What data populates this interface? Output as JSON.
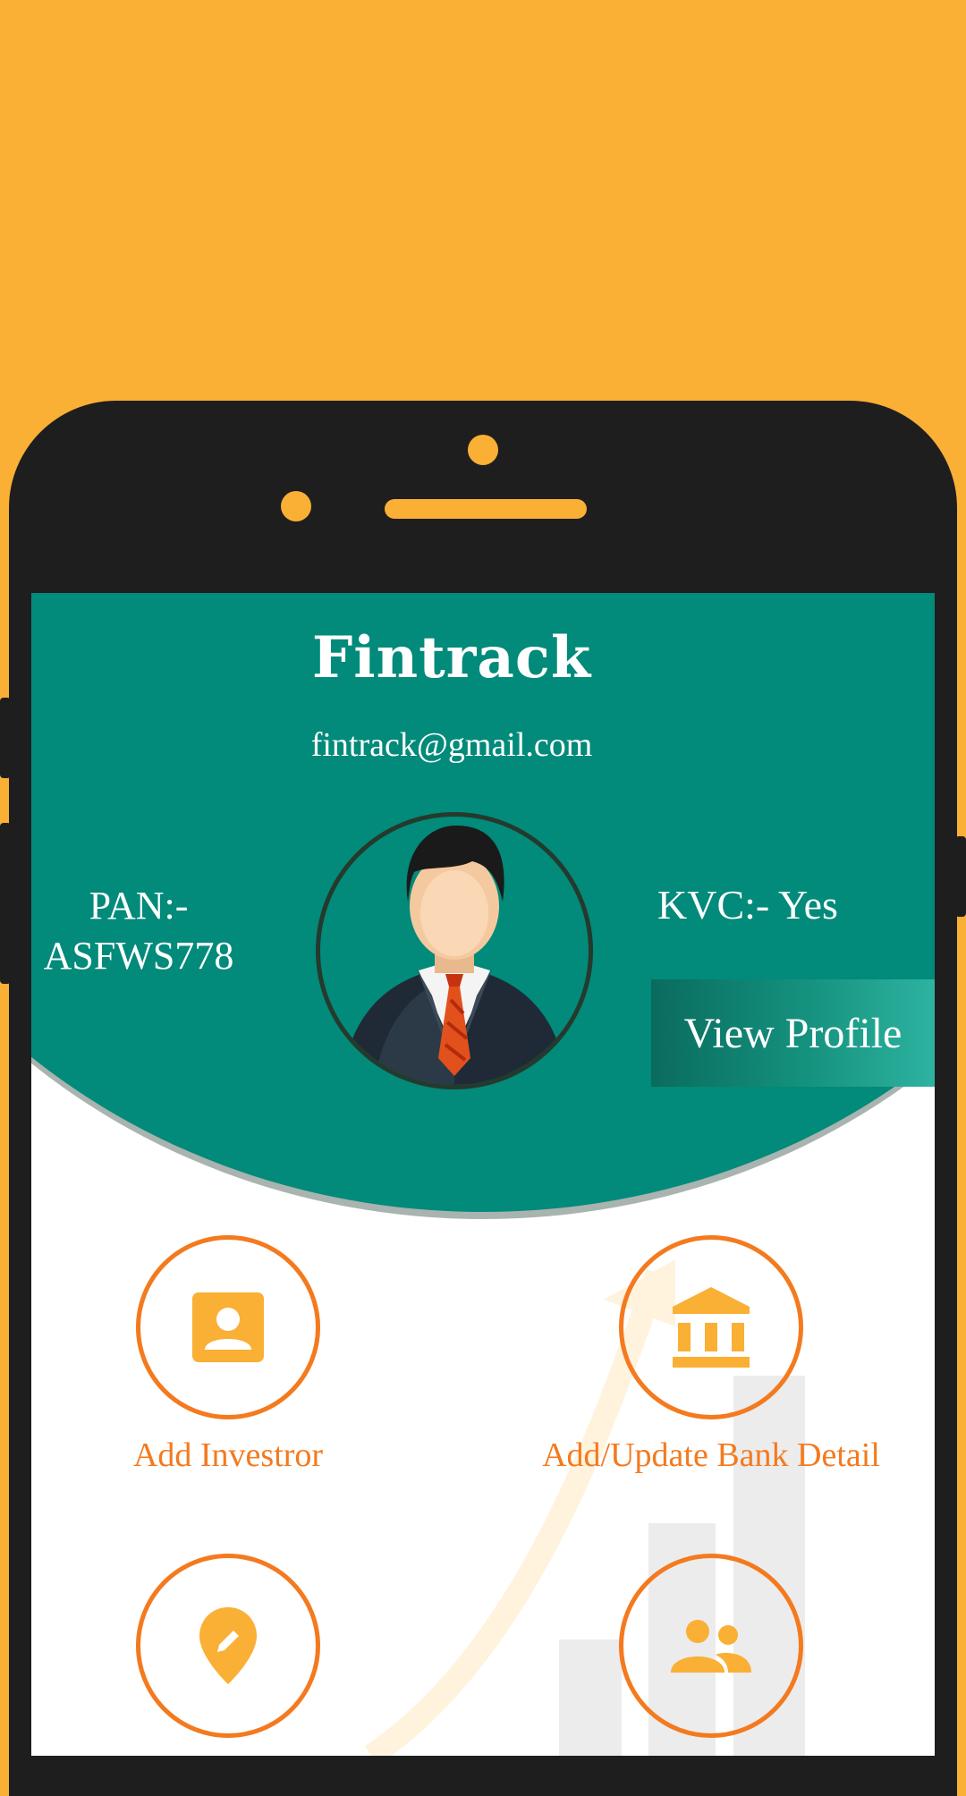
{
  "app": {
    "title": "Fintrack",
    "email": "fintrack@gmail.com"
  },
  "profile": {
    "pan_label": "PAN:-",
    "pan_value": "ASFWS778",
    "kvc_text": "KVC:- Yes",
    "view_profile_label": "View Profile",
    "avatar": "businessman-avatar"
  },
  "menu": [
    {
      "label": "Add Investror",
      "icon": "contact-card-icon"
    },
    {
      "label": "Add/Update Bank Detail",
      "icon": "bank-icon"
    },
    {
      "label": "",
      "icon": "location-edit-icon"
    },
    {
      "label": "",
      "icon": "people-icon"
    }
  ],
  "colors": {
    "background": "#FAAF35",
    "header": "#028A7A",
    "accent_orange": "#F47A1F",
    "icon_fill": "#FAAF35"
  }
}
